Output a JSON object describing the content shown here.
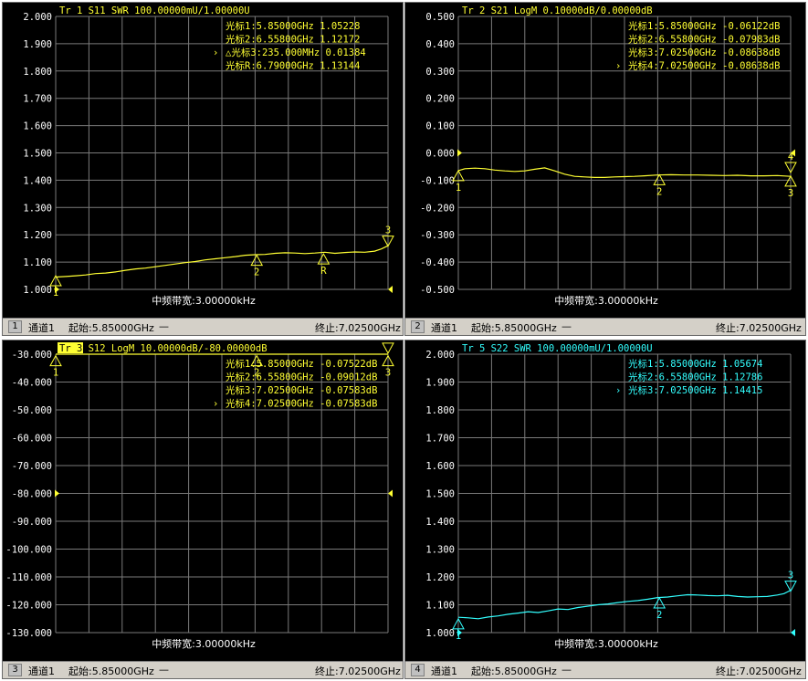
{
  "colors": {
    "yellow": "#ffff33",
    "cyan": "#33ffff",
    "grid": "#7a7a7a",
    "tick": "#ffffff"
  },
  "panels": [
    {
      "id": "tr1",
      "header": "Tr 1  S11 SWR 100.00000mU/1.00000U",
      "color": "yellow",
      "header_highlight": false,
      "ticks": [
        "2.000",
        "1.900",
        "1.800",
        "1.700",
        "1.600",
        "1.500",
        "1.400",
        "1.300",
        "1.200",
        "1.100",
        "1.000"
      ],
      "ymax": 2.0,
      "ymin": 1.0,
      "ref_value": 1.0,
      "markers_text": [
        "光标1:5.85000GHz 1.05228",
        "光标2:6.55800GHz 1.12172",
        "△光标3:235.000MHz 0.01384",
        "光标R:6.79000GHz 1.13144"
      ],
      "active_marker_row": 2,
      "trace": [
        [
          0,
          1.045
        ],
        [
          0.03,
          1.047
        ],
        [
          0.06,
          1.05
        ],
        [
          0.09,
          1.053
        ],
        [
          0.12,
          1.058
        ],
        [
          0.15,
          1.06
        ],
        [
          0.18,
          1.064
        ],
        [
          0.21,
          1.07
        ],
        [
          0.24,
          1.075
        ],
        [
          0.27,
          1.078
        ],
        [
          0.3,
          1.083
        ],
        [
          0.33,
          1.088
        ],
        [
          0.36,
          1.093
        ],
        [
          0.39,
          1.098
        ],
        [
          0.42,
          1.102
        ],
        [
          0.45,
          1.108
        ],
        [
          0.48,
          1.112
        ],
        [
          0.51,
          1.116
        ],
        [
          0.54,
          1.12
        ],
        [
          0.57,
          1.125
        ],
        [
          0.6,
          1.127
        ],
        [
          0.63,
          1.128
        ],
        [
          0.66,
          1.132
        ],
        [
          0.69,
          1.134
        ],
        [
          0.72,
          1.133
        ],
        [
          0.75,
          1.131
        ],
        [
          0.78,
          1.133
        ],
        [
          0.81,
          1.136
        ],
        [
          0.84,
          1.132
        ],
        [
          0.87,
          1.135
        ],
        [
          0.9,
          1.137
        ],
        [
          0.93,
          1.136
        ],
        [
          0.96,
          1.14
        ],
        [
          0.98,
          1.148
        ],
        [
          1.0,
          1.16
        ]
      ],
      "markers": [
        {
          "label": "1",
          "x": 0.0,
          "v": 1.03,
          "dir": "up"
        },
        {
          "label": "2",
          "x": 0.605,
          "v": 1.105,
          "dir": "up"
        },
        {
          "label": "R",
          "x": 0.806,
          "v": 1.11,
          "dir": "up"
        },
        {
          "label": "3",
          "x": 1.0,
          "v": 1.175,
          "dir": "down"
        }
      ],
      "footer": {
        "num": "1",
        "channel": "通道1",
        "start": "起始:5.85000GHz",
        "stop": "终止:7.02500GHz",
        "ifbw": "中频带宽:3.00000kHz"
      }
    },
    {
      "id": "tr2",
      "header": "Tr 2  S21 LogM 0.10000dB/0.00000dB",
      "color": "yellow",
      "header_highlight": false,
      "ticks": [
        "0.500",
        "0.400",
        "0.300",
        "0.200",
        "0.100",
        "0.000",
        "-0.100",
        "-0.200",
        "-0.300",
        "-0.400",
        "-0.500"
      ],
      "ymax": 0.5,
      "ymin": -0.5,
      "ref_value": 0.0,
      "markers_text": [
        "光标1:5.85000GHz -0.06122dB",
        "光标2:6.55800GHz -0.07983dB",
        "光标3:7.02500GHz -0.08638dB",
        "光标4:7.02500GHz -0.08638dB"
      ],
      "active_marker_row": 3,
      "trace": [
        [
          0,
          -0.065
        ],
        [
          0.02,
          -0.058
        ],
        [
          0.05,
          -0.056
        ],
        [
          0.08,
          -0.058
        ],
        [
          0.11,
          -0.063
        ],
        [
          0.14,
          -0.066
        ],
        [
          0.17,
          -0.068
        ],
        [
          0.2,
          -0.066
        ],
        [
          0.23,
          -0.06
        ],
        [
          0.26,
          -0.055
        ],
        [
          0.29,
          -0.066
        ],
        [
          0.32,
          -0.078
        ],
        [
          0.35,
          -0.086
        ],
        [
          0.38,
          -0.088
        ],
        [
          0.41,
          -0.09
        ],
        [
          0.44,
          -0.09
        ],
        [
          0.47,
          -0.088
        ],
        [
          0.5,
          -0.087
        ],
        [
          0.53,
          -0.086
        ],
        [
          0.56,
          -0.084
        ],
        [
          0.6,
          -0.081
        ],
        [
          0.64,
          -0.08
        ],
        [
          0.68,
          -0.081
        ],
        [
          0.72,
          -0.081
        ],
        [
          0.76,
          -0.082
        ],
        [
          0.8,
          -0.083
        ],
        [
          0.84,
          -0.082
        ],
        [
          0.88,
          -0.084
        ],
        [
          0.92,
          -0.084
        ],
        [
          0.96,
          -0.083
        ],
        [
          1.0,
          -0.086
        ]
      ],
      "markers": [
        {
          "label": "1",
          "x": 0.0,
          "v": -0.085,
          "dir": "up"
        },
        {
          "label": "2",
          "x": 0.605,
          "v": -0.1,
          "dir": "up"
        },
        {
          "label": "4",
          "x": 1.0,
          "v": -0.055,
          "dir": "down"
        },
        {
          "label": "3",
          "x": 1.0,
          "v": -0.105,
          "dir": "up"
        }
      ],
      "footer": {
        "num": "2",
        "channel": "通道1",
        "start": "起始:5.85000GHz",
        "stop": "终止:7.02500GHz",
        "ifbw": "中频带宽:3.00000kHz"
      }
    },
    {
      "id": "tr3",
      "header": "Tr 3  S12 LogM 10.00000dB/-80.00000dB",
      "color": "yellow",
      "header_highlight": true,
      "ticks": [
        "-30.000",
        "-40.000",
        "-50.000",
        "-60.000",
        "-70.000",
        "-80.000",
        "-90.000",
        "-100.000",
        "-110.000",
        "-120.000",
        "-130.000"
      ],
      "ymax": -30.0,
      "ymin": -130.0,
      "ref_value": -80.0,
      "markers_text": [
        "光标1:5.85000GHz -0.07522dB",
        "光标2:6.55800GHz -0.09012dB",
        "光标3:7.02500GHz -0.07583dB",
        "光标4:7.02500GHz -0.07583dB"
      ],
      "active_marker_row": 3,
      "trace": [
        [
          0,
          -30.0
        ],
        [
          1.0,
          -30.0
        ]
      ],
      "markers": [
        {
          "label": "1",
          "x": 0.0,
          "v": -32.5,
          "dir": "up"
        },
        {
          "label": "2",
          "x": 0.605,
          "v": -32.5,
          "dir": "up"
        },
        {
          "label": "4",
          "x": 1.0,
          "v": -28.0,
          "dir": "down"
        },
        {
          "label": "3",
          "x": 1.0,
          "v": -32.5,
          "dir": "up"
        }
      ],
      "footer": {
        "num": "3",
        "channel": "通道1",
        "start": "起始:5.85000GHz",
        "stop": "终止:7.02500GHz",
        "ifbw": "中频带宽:3.00000kHz"
      }
    },
    {
      "id": "tr5",
      "header": "Tr 5  S22 SWR 100.00000mU/1.00000U",
      "color": "cyan",
      "header_highlight": false,
      "ticks": [
        "2.000",
        "1.900",
        "1.800",
        "1.700",
        "1.600",
        "1.500",
        "1.400",
        "1.300",
        "1.200",
        "1.100",
        "1.000"
      ],
      "ymax": 2.0,
      "ymin": 1.0,
      "ref_value": 1.0,
      "markers_text": [
        "光标1:5.85000GHz 1.05674",
        "光标2:6.55800GHz 1.12786",
        "光标3:7.02500GHz 1.14415"
      ],
      "active_marker_row": 2,
      "trace": [
        [
          0,
          1.055
        ],
        [
          0.03,
          1.053
        ],
        [
          0.06,
          1.05
        ],
        [
          0.09,
          1.056
        ],
        [
          0.12,
          1.06
        ],
        [
          0.15,
          1.066
        ],
        [
          0.18,
          1.07
        ],
        [
          0.21,
          1.075
        ],
        [
          0.24,
          1.072
        ],
        [
          0.27,
          1.078
        ],
        [
          0.3,
          1.085
        ],
        [
          0.33,
          1.083
        ],
        [
          0.36,
          1.09
        ],
        [
          0.39,
          1.095
        ],
        [
          0.42,
          1.1
        ],
        [
          0.45,
          1.103
        ],
        [
          0.48,
          1.108
        ],
        [
          0.51,
          1.112
        ],
        [
          0.54,
          1.115
        ],
        [
          0.57,
          1.12
        ],
        [
          0.6,
          1.126
        ],
        [
          0.63,
          1.128
        ],
        [
          0.66,
          1.132
        ],
        [
          0.69,
          1.136
        ],
        [
          0.72,
          1.135
        ],
        [
          0.75,
          1.133
        ],
        [
          0.78,
          1.132
        ],
        [
          0.81,
          1.134
        ],
        [
          0.84,
          1.13
        ],
        [
          0.87,
          1.128
        ],
        [
          0.9,
          1.129
        ],
        [
          0.93,
          1.13
        ],
        [
          0.96,
          1.135
        ],
        [
          0.98,
          1.14
        ],
        [
          1.0,
          1.152
        ]
      ],
      "markers": [
        {
          "label": "1",
          "x": 0.0,
          "v": 1.03,
          "dir": "up"
        },
        {
          "label": "2",
          "x": 0.605,
          "v": 1.105,
          "dir": "up"
        },
        {
          "label": "3",
          "x": 1.0,
          "v": 1.165,
          "dir": "down"
        }
      ],
      "footer": {
        "num": "4",
        "channel": "通道1",
        "start": "起始:5.85000GHz",
        "stop": "终止:7.02500GHz",
        "ifbw": "中频带宽:3.00000kHz"
      }
    }
  ]
}
